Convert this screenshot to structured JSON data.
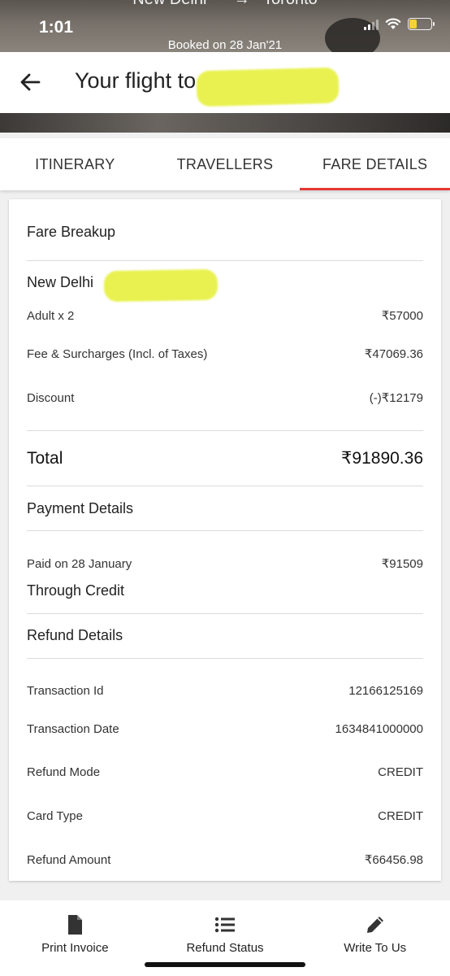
{
  "status_bar": {
    "time": "1:01"
  },
  "hero": {
    "route_text": "New Delhi      →   Toronto",
    "booked_text": "Booked on 28 Jan'21"
  },
  "header": {
    "title": "Your flight to"
  },
  "tabs": [
    {
      "label": "ITINERARY",
      "active": false
    },
    {
      "label": "TRAVELLERS",
      "active": false
    },
    {
      "label": "FARE DETAILS",
      "active": true
    }
  ],
  "fare": {
    "heading": "Fare Breakup",
    "route_from": "New Delhi",
    "rows": [
      {
        "label": "Adult x 2",
        "value": "₹57000"
      },
      {
        "label": "Fee & Surcharges (Incl. of Taxes)",
        "value": "₹47069.36"
      },
      {
        "label": "Discount",
        "value": "(-)₹12179"
      }
    ],
    "total_label": "Total",
    "total_value": "₹91890.36"
  },
  "payment": {
    "heading": "Payment Details",
    "paid_label": "Paid on 28 January",
    "paid_value": "₹91509",
    "method": "Through Credit"
  },
  "refund": {
    "heading": "Refund Details",
    "rows": [
      {
        "label": "Transaction Id",
        "value": "12166125169"
      },
      {
        "label": "Transaction Date",
        "value": "1634841000000"
      },
      {
        "label": "Refund Mode",
        "value": "CREDIT"
      },
      {
        "label": "Card Type",
        "value": "CREDIT"
      },
      {
        "label": "Refund Amount",
        "value": "₹66456.98"
      }
    ]
  },
  "bottom_nav": [
    {
      "label": "Print Invoice",
      "icon": "document-icon"
    },
    {
      "label": "Refund Status",
      "icon": "list-icon"
    },
    {
      "label": "Write To Us",
      "icon": "pencil-icon"
    }
  ],
  "colors": {
    "active_tab_underline": "#e53935",
    "highlighter": "#e6f03a"
  }
}
